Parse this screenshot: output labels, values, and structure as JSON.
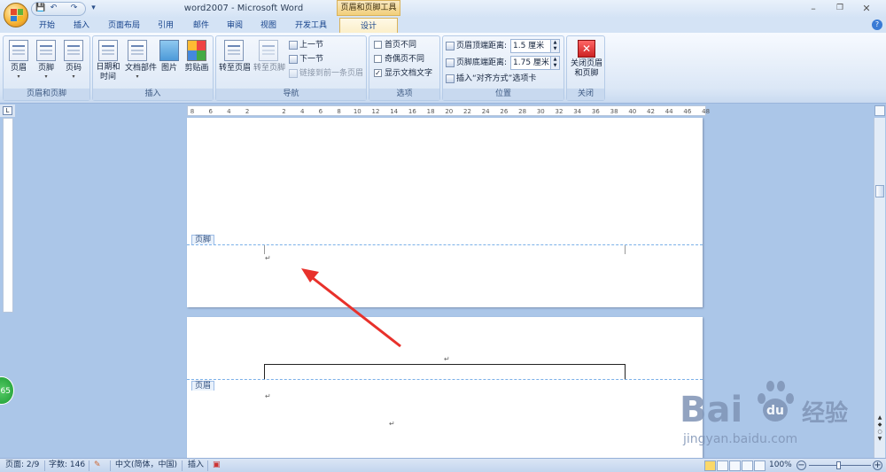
{
  "window": {
    "title": "word2007 - Microsoft Word",
    "context_tools": "页眉和页脚工具",
    "minimize": "–",
    "restore": "❐",
    "close": "✕"
  },
  "qat": {
    "save": "💾",
    "undo": "↶",
    "redo": "↷",
    "customize": "▾"
  },
  "tabs": [
    "开始",
    "插入",
    "页面布局",
    "引用",
    "邮件",
    "审阅",
    "视图",
    "开发工具",
    "设计"
  ],
  "active_tab": "设计",
  "help": "?",
  "ribbon": {
    "group_header_footer": {
      "label": "页眉和页脚",
      "header": "页眉",
      "footer": "页脚",
      "page_number": "页码"
    },
    "group_insert": {
      "label": "插入",
      "datetime_line1": "日期和",
      "datetime_line2": "时间",
      "quick_parts": "文档部件",
      "picture": "图片",
      "clipart": "剪贴画"
    },
    "group_navigation": {
      "label": "导航",
      "goto_header": "转至页眉",
      "goto_footer": "转至页脚",
      "prev_section": "上一节",
      "next_section": "下一节",
      "link_previous": "链接到前一条页眉"
    },
    "group_options": {
      "label": "选项",
      "diff_first": "首页不同",
      "diff_odd_even": "奇偶页不同",
      "show_doc_text": "显示文档文字",
      "diff_first_checked": false,
      "diff_odd_even_checked": false,
      "show_doc_text_checked": true
    },
    "group_position": {
      "label": "位置",
      "header_top_label": "页眉顶端距离:",
      "header_top_value": "1.5 厘米",
      "footer_bottom_label": "页脚底端距离:",
      "footer_bottom_value": "1.75 厘米",
      "insert_align_tab": "插入“对齐方式”选项卡"
    },
    "group_close": {
      "label": "关闭",
      "close_line1": "关闭页眉",
      "close_line2": "和页脚"
    }
  },
  "ruler": {
    "ticks": [
      "8",
      "6",
      "4",
      "2",
      "",
      "2",
      "4",
      "6",
      "8",
      "10",
      "12",
      "14",
      "16",
      "18",
      "20",
      "22",
      "24",
      "26",
      "28",
      "30",
      "32",
      "34",
      "36",
      "38",
      "40",
      "42",
      "44",
      "46",
      "48"
    ]
  },
  "document": {
    "footer_tag": "页脚",
    "header_tag": "页眉",
    "para_mark": "↵"
  },
  "badge": "65",
  "watermark": {
    "brand": "Bai",
    "paw": "du",
    "jingyan": "经验",
    "url": "jingyan.baidu.com"
  },
  "status": {
    "page": "页面: 2/9",
    "words": "字数: 146",
    "language": "中文(简体，中国)",
    "insert_mode": "插入",
    "zoom": "100%",
    "zoom_minus": "−",
    "zoom_plus": "+"
  }
}
